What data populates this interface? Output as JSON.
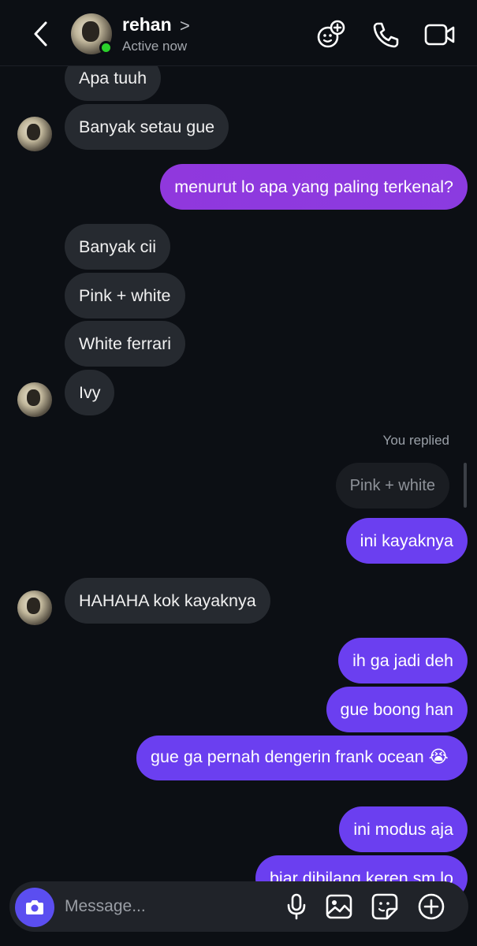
{
  "header": {
    "contact_name": "rehan",
    "name_chevron": ">",
    "status": "Active now",
    "icons": [
      "back-icon",
      "avatar-effects-icon",
      "phone-icon",
      "video-camera-icon"
    ]
  },
  "messages": [
    {
      "from": "them",
      "text": "Apa tuuh"
    },
    {
      "from": "them",
      "text": "Banyak setau gue"
    },
    {
      "from": "me",
      "text": "menurut lo apa yang paling terkenal?"
    },
    {
      "from": "them",
      "text": "Banyak cii"
    },
    {
      "from": "them",
      "text": "Pink + white"
    },
    {
      "from": "them",
      "text": "White ferrari"
    },
    {
      "from": "them",
      "text": "Ivy"
    },
    {
      "from": "me",
      "text": "ini kayaknya"
    },
    {
      "from": "them",
      "text": "HAHAHA kok kayaknya"
    },
    {
      "from": "me",
      "text": "ih ga jadi deh"
    },
    {
      "from": "me",
      "text": "gue boong han"
    },
    {
      "from": "me",
      "text": "gue ga pernah dengerin frank ocean 😭"
    },
    {
      "from": "me",
      "text": "ini modus aja"
    },
    {
      "from": "me",
      "text": "biar dibilang keren sm lo"
    }
  ],
  "reply": {
    "label": "You replied",
    "quoted_text": "Pink + white"
  },
  "composer": {
    "placeholder": "Message...",
    "icons": [
      "camera-icon",
      "microphone-icon",
      "gallery-icon",
      "sticker-icon",
      "plus-icon"
    ]
  },
  "colors": {
    "background": "#0c0f14",
    "incoming_bubble": "#262a30",
    "outgoing_purple": "#8b3be0",
    "outgoing_violet": "#6b3ff0",
    "online": "#2bd12b",
    "camera_button": "#5b4ef0"
  }
}
